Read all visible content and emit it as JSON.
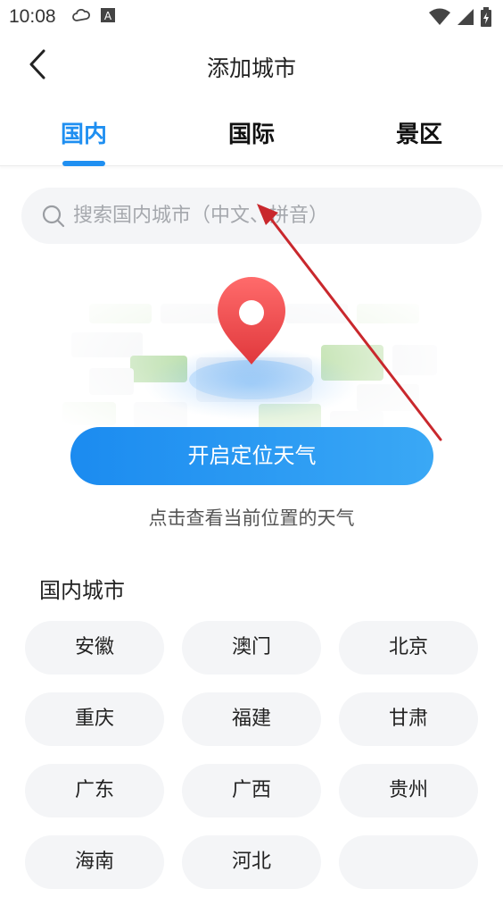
{
  "status_bar": {
    "time": "10:08",
    "icons": [
      "cloud-icon",
      "text-a-icon",
      "wifi-icon",
      "signal-icon",
      "battery-charging-icon"
    ]
  },
  "header": {
    "title": "添加城市",
    "back_icon": "chevron-left-icon"
  },
  "tabs": [
    {
      "label": "国内",
      "active": true
    },
    {
      "label": "国际",
      "active": false
    },
    {
      "label": "景区",
      "active": false
    }
  ],
  "search": {
    "placeholder": "搜索国内城市（中文、拼音）",
    "value": "",
    "icon": "search-icon"
  },
  "locate": {
    "button_label": "开启定位天气",
    "hint": "点击查看当前位置的天气"
  },
  "domestic": {
    "section_title": "国内城市",
    "cities": [
      "安徽",
      "澳门",
      "北京",
      "重庆",
      "福建",
      "甘肃",
      "广东",
      "广西",
      "贵州",
      "海南",
      "河北",
      ""
    ]
  },
  "colors": {
    "accent": "#1f8ff1",
    "chip_bg": "#f4f5f7",
    "annotation": "#c9282d"
  }
}
